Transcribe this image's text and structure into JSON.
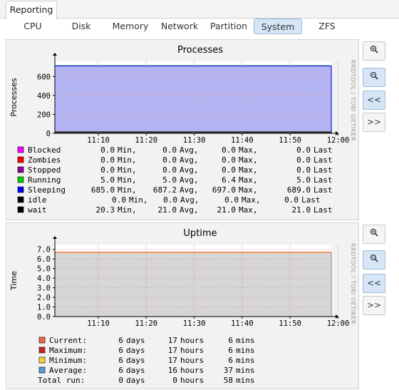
{
  "header": {
    "tab": "Reporting"
  },
  "subtabs": [
    "CPU",
    "Disk",
    "Memory",
    "Network",
    "Partition",
    "System",
    "ZFS"
  ],
  "active_subtab": "System",
  "side_label": "RRDTOOL / TOBI OETIKER",
  "buttons": {
    "back": "<<",
    "forward": ">>"
  },
  "chart_data": [
    {
      "type": "area",
      "title": "Processes",
      "ylabel": "Processes",
      "ylim": [
        0,
        760
      ],
      "yticks": [
        "0",
        "200",
        "400",
        "600"
      ],
      "xticks": [
        "11:10",
        "11:20",
        "11:30",
        "11:40",
        "11:50",
        "12:00"
      ],
      "series": [
        {
          "name": "Blocked",
          "color": "#ff00ff",
          "min": "0.0",
          "avg": "0.0",
          "max": "0.0",
          "last": "0.0"
        },
        {
          "name": "Zombies",
          "color": "#ff0000",
          "min": "0.0",
          "avg": "0.0",
          "max": "0.0",
          "last": "0.0"
        },
        {
          "name": "Stopped",
          "color": "#990099",
          "min": "0.0",
          "avg": "0.0",
          "max": "0.0",
          "last": "0.0"
        },
        {
          "name": "Running",
          "color": "#00cc00",
          "min": "5.0",
          "avg": "5.0",
          "max": "6.4",
          "last": "5.0"
        },
        {
          "name": "Sleeping",
          "color": "#0000ff",
          "min": "685.0",
          "avg": "687.2",
          "max": "697.0",
          "last": "689.0",
          "area_value": 690
        },
        {
          "name": "idle",
          "color": "#000000",
          "min": "0.0",
          "avg": "0.0",
          "max": "0.0",
          "last": "0.0"
        },
        {
          "name": "wait",
          "color": "#000000",
          "min": "20.3",
          "avg": "21.0",
          "max": "21.0",
          "last": "21.0",
          "area_value": 21
        }
      ],
      "legend_columns": [
        "Min,",
        "Avg,",
        "Max,",
        "Last"
      ]
    },
    {
      "type": "area",
      "title": "Uptime",
      "ylabel": "Time",
      "ylim": [
        0,
        7.5
      ],
      "yticks": [
        "0.0",
        "1.0",
        "2.0",
        "3.0",
        "4.0",
        "5.0",
        "6.0",
        "7.0"
      ],
      "xticks": [
        "11:10",
        "11:20",
        "11:30",
        "11:40",
        "11:50",
        "12:00"
      ],
      "area_value": 6.7,
      "rows": [
        {
          "label": "Current:",
          "color": "#ee6644",
          "days": "6",
          "hours": "17",
          "mins": "6"
        },
        {
          "label": "Maximum:",
          "color": "#cc2222",
          "days": "6",
          "hours": "17",
          "mins": "6"
        },
        {
          "label": "Minimum:",
          "color": "#ffcc33",
          "days": "6",
          "hours": "17",
          "mins": "6"
        },
        {
          "label": "Average:",
          "color": "#5599dd",
          "days": "6",
          "hours": "16",
          "mins": "37"
        },
        {
          "label": "Total run:",
          "color": "",
          "days": "0",
          "hours": "0",
          "mins": "58"
        }
      ],
      "units": {
        "days": "days",
        "hours": "hours",
        "mins": "mins"
      }
    }
  ]
}
